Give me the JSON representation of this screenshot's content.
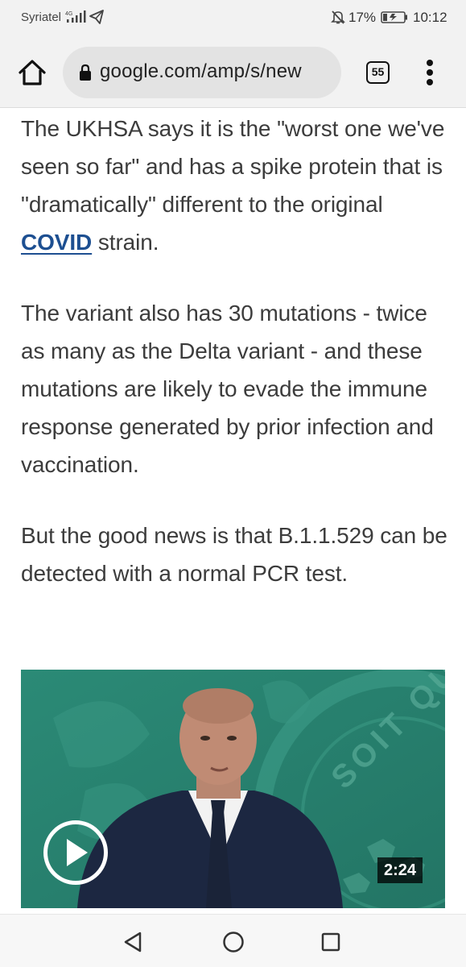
{
  "status_bar": {
    "carrier": "Syriatel",
    "network": "4G",
    "battery_percent": "17%",
    "time": "10:12",
    "icons": [
      "signal-icon",
      "telegram-icon",
      "mute-icon",
      "battery-icon"
    ]
  },
  "toolbar": {
    "url": "google.com/amp/s/new",
    "tab_count": "55",
    "icons": [
      "home-icon",
      "lock-icon",
      "tabs-icon",
      "more-vert-icon"
    ]
  },
  "article": {
    "paragraphs": [
      {
        "before": "The UKHSA says it is the \"worst one we've seen so far\" and has a spike protein that is \"dramatically\" different to the original ",
        "link": "COVID",
        "after": " strain."
      },
      {
        "text": "The variant also has 30 mutations - twice as many as the Delta variant - and these mutations are likely to evade the immune response generated by prior infection and vaccination."
      },
      {
        "text": "But the good news is that B.1.1.529 can be detected with a normal PCR test."
      }
    ]
  },
  "video": {
    "duration": "2:24",
    "background_color": "#2f8a78",
    "overlay_text": "SOIT QU"
  },
  "colors": {
    "link": "#1d4f91",
    "body_text": "#3c3c3c",
    "chrome_bg": "#f2f2f2"
  }
}
